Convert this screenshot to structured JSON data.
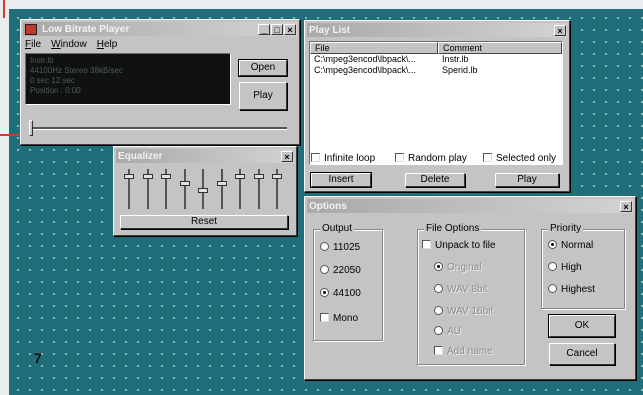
{
  "player": {
    "title": "Low Bitrate Player",
    "menu": [
      "File",
      "Window",
      "Help"
    ],
    "display": [
      "Instr.lb",
      "44100Hz  Stereo  38kB/sec",
      "0 sec 12 sec",
      "Position : 0:00"
    ],
    "open_label": "Open",
    "play_label": "Play",
    "position_value": 0
  },
  "playlist": {
    "title": "Play List",
    "columns": [
      "File",
      "Comment"
    ],
    "rows": [
      {
        "file": "C:\\mpeg3encod\\lbpack\\...",
        "comment": "Instr.lb"
      },
      {
        "file": "C:\\mpeg3encod\\lbpack\\...",
        "comment": "Sperid.lb"
      }
    ],
    "infinite_loop": "Infinite loop",
    "random_play": "Random play",
    "selected_only": "Selected only",
    "insert_label": "Insert",
    "delete_label": "Delete",
    "play_label": "Play"
  },
  "equalizer": {
    "title": "Equalizer",
    "band_levels": [
      0.15,
      0.15,
      0.15,
      0.35,
      0.55,
      0.35,
      0.15,
      0.15,
      0.15
    ],
    "reset_label": "Reset"
  },
  "options": {
    "title": "Options",
    "output": {
      "label": "Output",
      "rates": [
        "11025",
        "22050",
        "44100"
      ],
      "selected": "44100",
      "mono": "Mono"
    },
    "file_options": {
      "label": "File Options",
      "unpack": "Unpack to file",
      "formats": [
        "Original",
        "WAV 8bit",
        "WAV 16bit",
        "AU"
      ],
      "add_name": "Add name"
    },
    "priority": {
      "label": "Priority",
      "levels": [
        "Normal",
        "High",
        "Highest"
      ],
      "selected": "Normal"
    },
    "ok_label": "OK",
    "cancel_label": "Cancel"
  },
  "page": {
    "number": "7"
  }
}
